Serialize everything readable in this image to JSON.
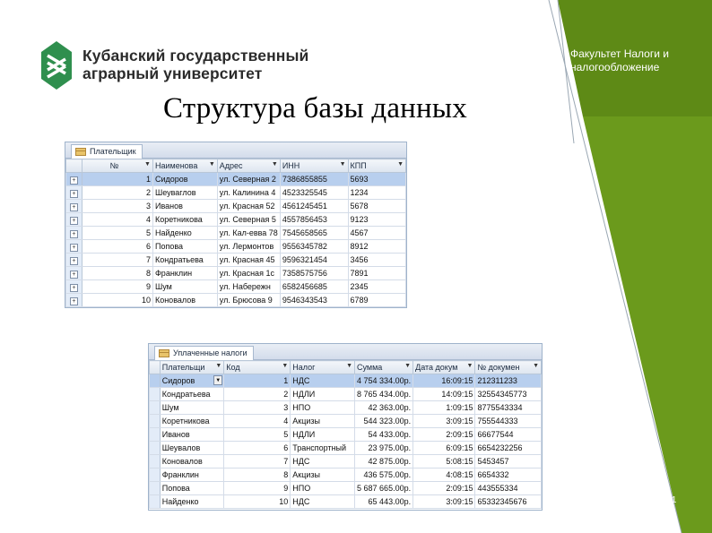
{
  "university": {
    "name_line1": "Кубанский государственный",
    "name_line2": "аграрный университет"
  },
  "faculty": {
    "line1": "Факультет Налоги и",
    "line2": "налогообложение"
  },
  "slide_title": "Структура базы данных",
  "slide_number": "11",
  "colors": {
    "green_dark": "#5e8a16",
    "green_light": "#8dbb2f",
    "logo_green": "#2f8f4e",
    "row_highlight": "#b8cfee"
  },
  "table1": {
    "tab_label": "Плательщик",
    "columns": [
      "№",
      "Наименова",
      "Адрес",
      "ИНН",
      "КПП"
    ],
    "rows": [
      [
        "1",
        "Сидоров",
        "ул. Северная 2",
        "7386855855",
        "5693"
      ],
      [
        "2",
        "Шеуваглов",
        "ул. Калинина 4",
        "4523325545",
        "1234"
      ],
      [
        "3",
        "Иванов",
        "ул. Красная 52",
        "4561245451",
        "5678"
      ],
      [
        "4",
        "Коретникова",
        "ул. Северная 5",
        "4557856453",
        "9123"
      ],
      [
        "5",
        "Найденко",
        "ул. Кал-евва 78",
        "7545658565",
        "4567"
      ],
      [
        "6",
        "Попова",
        "ул. Лермонтов",
        "9556345782",
        "8912"
      ],
      [
        "7",
        "Кондратьева",
        "ул. Красная 45",
        "9596321454",
        "3456"
      ],
      [
        "8",
        "Франклин",
        "ул. Красная 1с",
        "7358575756",
        "7891"
      ],
      [
        "9",
        "Шум",
        "ул. Набережн",
        "6582456685",
        "2345"
      ],
      [
        "10",
        "Коновалов",
        "ул. Брюсова 9",
        "9546343543",
        "6789"
      ]
    ]
  },
  "table2": {
    "tab_label": "Уплаченные налоги",
    "columns": [
      "Плательщи",
      "Код",
      "Налог",
      "Сумма",
      "Дата докум",
      "№ докумен"
    ],
    "rows": [
      [
        "Сидоров",
        "1",
        "НДС",
        "4 754 334.00р.",
        "16:09:15",
        "212311233"
      ],
      [
        "Кондратьева",
        "2",
        "НДЛИ",
        "8 765 434.00р.",
        "14:09:15",
        "32554345773"
      ],
      [
        "Шум",
        "3",
        "НПО",
        "42 363.00р.",
        "1:09:15",
        "8775543334"
      ],
      [
        "Коретникова",
        "4",
        "Акцизы",
        "544 323.00р.",
        "3:09:15",
        "755544333"
      ],
      [
        "Иванов",
        "5",
        "НДЛИ",
        "54 433.00р.",
        "2:09:15",
        "66677544"
      ],
      [
        "Шеувалов",
        "6",
        "Транспортный",
        "23 975.00р.",
        "6:09:15",
        "6654232256"
      ],
      [
        "Коновалов",
        "7",
        "НДС",
        "42 875.00р.",
        "5:08:15",
        "5453457"
      ],
      [
        "Франклин",
        "8",
        "Акцизы",
        "436 575.00р.",
        "4:08:15",
        "6654332"
      ],
      [
        "Попова",
        "9",
        "НПО",
        "5 687 665.00р.",
        "2:09:15",
        "443555334"
      ],
      [
        "Найденко",
        "10",
        "НДС",
        "65 443.00р.",
        "3:09:15",
        "65332345676"
      ]
    ]
  }
}
